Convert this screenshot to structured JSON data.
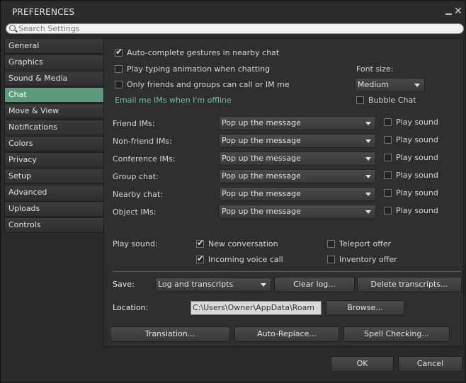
{
  "window": {
    "title": "PREFERENCES",
    "close_glyph": "✕"
  },
  "search": {
    "placeholder": "Search Settings"
  },
  "sidebar": {
    "items": [
      {
        "label": "General"
      },
      {
        "label": "Graphics"
      },
      {
        "label": "Sound & Media"
      },
      {
        "label": "Chat"
      },
      {
        "label": "Move & View"
      },
      {
        "label": "Notifications"
      },
      {
        "label": "Colors"
      },
      {
        "label": "Privacy"
      },
      {
        "label": "Setup"
      },
      {
        "label": "Advanced"
      },
      {
        "label": "Uploads"
      },
      {
        "label": "Controls"
      }
    ],
    "active": "Chat"
  },
  "chat": {
    "autocomplete": {
      "label": "Auto-complete gestures in nearby chat",
      "checked": true
    },
    "typing_anim": {
      "label": "Play typing animation when chatting",
      "checked": false
    },
    "only_friends": {
      "label": "Only friends and groups can call or IM me",
      "checked": false
    },
    "email_link": "Email me IMs when I'm offline",
    "font_size_label": "Font size:",
    "font_size_value": "Medium",
    "bubble_chat": {
      "label": "Bubble Chat",
      "checked": false
    },
    "im_rows": [
      {
        "label": "Friend IMs:",
        "value": "Pop up the message",
        "sound": "Play sound"
      },
      {
        "label": "Non-friend IMs:",
        "value": "Pop up the message",
        "sound": "Play sound"
      },
      {
        "label": "Conference IMs:",
        "value": "Pop up the message",
        "sound": "Play sound"
      },
      {
        "label": "Group chat:",
        "value": "Pop up the message",
        "sound": "Play sound"
      },
      {
        "label": "Nearby chat:",
        "value": "Pop up the message",
        "sound": "Play sound"
      },
      {
        "label": "Object IMs:",
        "value": "Pop up the message",
        "sound": "Play sound"
      }
    ],
    "play_sound_label": "Play sound:",
    "sounds": {
      "new_conversation": {
        "label": "New conversation",
        "checked": true
      },
      "incoming_voice": {
        "label": "Incoming voice call",
        "checked": true
      },
      "teleport_offer": {
        "label": "Teleport offer",
        "checked": false
      },
      "inventory_offer": {
        "label": "Inventory offer",
        "checked": false
      }
    },
    "save_label": "Save:",
    "save_value": "Log and transcripts",
    "clear_log": "Clear log...",
    "delete_transcripts": "Delete transcripts...",
    "location_label": "Location:",
    "location_value": "C:\\Users\\Owner\\AppData\\Roam",
    "browse": "Browse...",
    "translation": "Translation...",
    "auto_replace": "Auto-Replace...",
    "spell_checking": "Spell Checking..."
  },
  "footer": {
    "ok": "OK",
    "cancel": "Cancel"
  },
  "colors": {
    "active_tab": "#5b9a7d",
    "link": "#6fbfa0"
  }
}
